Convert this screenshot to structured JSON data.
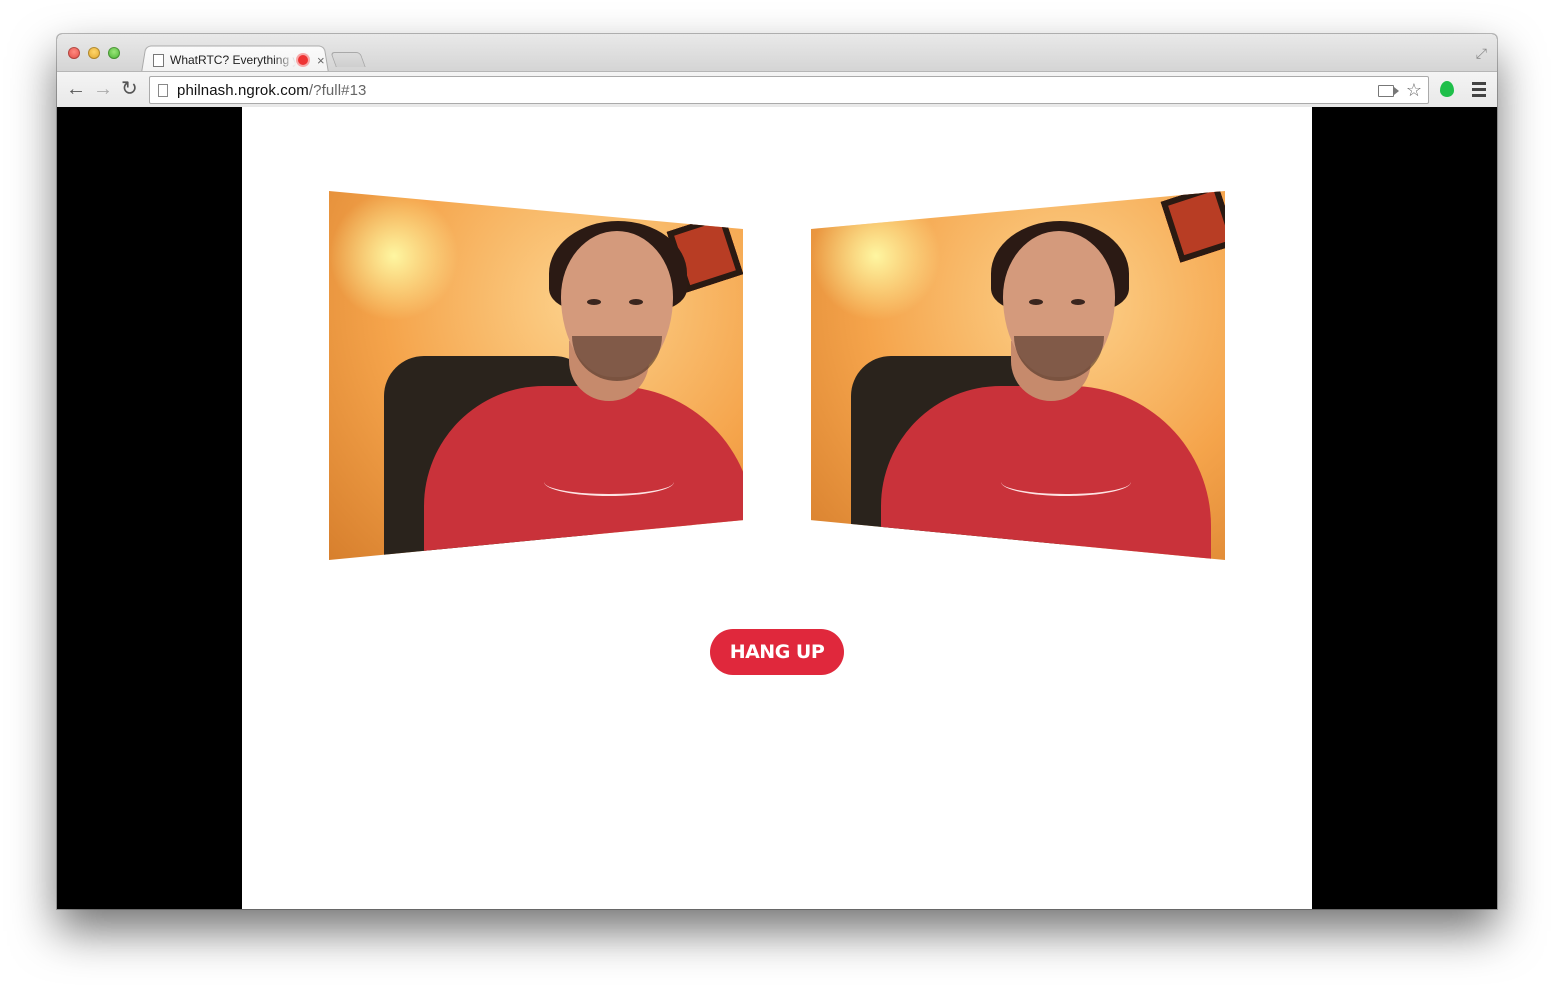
{
  "browser": {
    "tab": {
      "title": "WhatRTC? Everything you",
      "close_glyph": "×"
    },
    "toolbar": {
      "back_glyph": "←",
      "forward_glyph": "→",
      "reload_glyph": "↻",
      "url_host": "philnash.ngrok.com",
      "url_path": "/?full#13",
      "star_glyph": "☆",
      "fullscreen_glyph": "⤢"
    },
    "icons": [
      "document-icon",
      "recording-icon",
      "close-icon",
      "back-icon",
      "forward-icon",
      "reload-icon",
      "camera-icon",
      "star-icon",
      "extension-icon",
      "menu-icon",
      "fullscreen-icon"
    ]
  },
  "page": {
    "hangup_label": "HANG UP",
    "videos": [
      {
        "name": "local-video"
      },
      {
        "name": "remote-video"
      }
    ]
  },
  "colors": {
    "hangup": "#e0283c",
    "letterbox": "#000000",
    "slide": "#ffffff",
    "extension": "#1fbf4a"
  }
}
